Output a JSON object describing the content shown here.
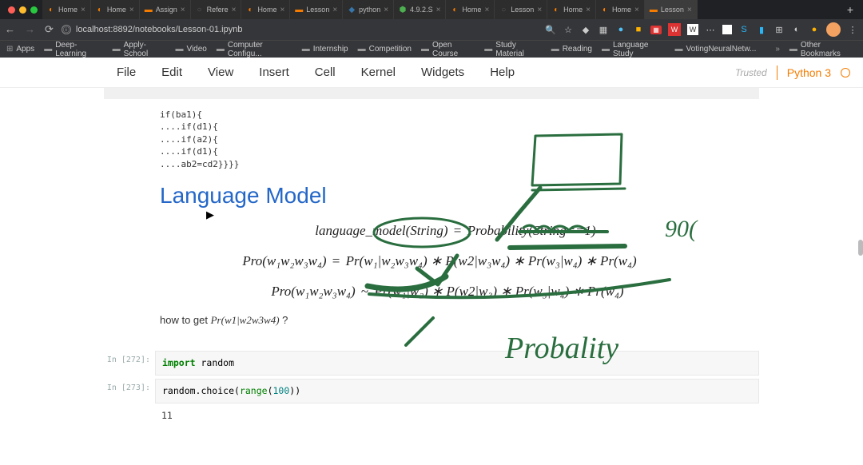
{
  "browser": {
    "url_display": "localhost:8892/notebooks/Lesson-01.ipynb",
    "tabs": [
      {
        "favicon": "jupyter",
        "title": "Home"
      },
      {
        "favicon": "jupyter",
        "title": "Home"
      },
      {
        "favicon": "orange",
        "title": "Assign"
      },
      {
        "favicon": "none",
        "title": "Refere"
      },
      {
        "favicon": "jupyter",
        "title": "Home"
      },
      {
        "favicon": "orange",
        "title": "Lesson"
      },
      {
        "favicon": "python",
        "title": "python"
      },
      {
        "favicon": "green",
        "title": "4.9.2.S"
      },
      {
        "favicon": "jupyter",
        "title": "Home"
      },
      {
        "favicon": "none",
        "title": "Lesson"
      },
      {
        "favicon": "jupyter",
        "title": "Home"
      },
      {
        "favicon": "jupyter",
        "title": "Home"
      },
      {
        "favicon": "orange",
        "title": "Lesson",
        "active": true
      }
    ],
    "bookmarks": [
      "Apps",
      "Deep-Learning",
      "Apply-School",
      "Video",
      "Computer Configu...",
      "Internship",
      "Competition",
      "Open Course",
      "Study Material",
      "Reading",
      "Language Study",
      "VotingNeuralNetw..."
    ],
    "other_bookmarks": "Other Bookmarks"
  },
  "jupyter": {
    "menu": [
      "File",
      "Edit",
      "View",
      "Insert",
      "Cell",
      "Kernel",
      "Widgets",
      "Help"
    ],
    "trusted": "Trusted",
    "kernel": "Python 3"
  },
  "notebook": {
    "raw_code": "if(ba1){\n....if(d1){\n....if(a2){\n....if(d1){\n....ab2=cd2}}}}",
    "heading": "Language Model",
    "eq1_lhs": "language_model(String)",
    "eq1_rhs": "Probability(String==1)",
    "eq2_lhs": "Pro(w₁w₂w₃w₄)",
    "eq2_rhs": "Pr(w₁|w₂w₃w₄) ∗ P(w2|w₃w₄) ∗ Pr(w₃|w₄) ∗ Pr(w₄)",
    "eq3_lhs": "Pro(w₁w₂w₃w₄)",
    "eq3_rhs": "Pr(w₁|w₂) ∗ P(w2|w₃) ∗ Pr(w₃|w₄) ∗ Pr(w₄)",
    "howto_prefix": "how to get ",
    "howto_math": "Pr(w1|w2w3w4)",
    "howto_suffix": " ?",
    "cell1_prompt": "In [272]:",
    "cell1_code_kw": "import",
    "cell1_code_rest": " random",
    "cell2_prompt": "In [273]:",
    "cell2_code_a": "random.choice(",
    "cell2_code_b": "range",
    "cell2_code_c": "(",
    "cell2_code_d": "100",
    "cell2_code_e": "))",
    "out_value": "11"
  },
  "ink": {
    "stroke_color": "#2a6e3f",
    "scribble_number": "90(",
    "scribble_word": "Probality"
  }
}
